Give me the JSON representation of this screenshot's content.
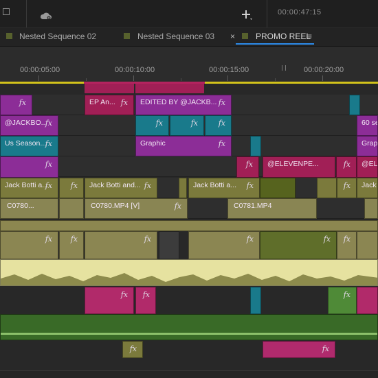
{
  "timecode": "00:00:47:15",
  "tabs": [
    {
      "label": "Nested Sequence 02"
    },
    {
      "label": "Nested Sequence 03"
    },
    {
      "label": "PROMO REEL",
      "close": "×",
      "menu": "≡"
    }
  ],
  "ruler": {
    "labels": [
      "00:00:05:00",
      "00:00:10:00",
      "00:00:15:00",
      "00:00:20:00"
    ]
  },
  "clips": {
    "ep_an": "EP An...",
    "edited_by": "EDITED BY @JACKB...",
    "jackbo": "@JACKBO...",
    "sixty_se": "60 se",
    "us_season": "Us Season...",
    "graphic": "Graphic",
    "graph": "Graph",
    "elevenpe": "@ELEVENPE...",
    "ele": "@ELE",
    "jack_botti_a": "Jack Botti a...",
    "jack_botti_and": "Jack Botti and...",
    "jack_botti_a2": "Jack Botti a...",
    "jack_b": "Jack B",
    "c0780": "C0780...",
    "c0780_v": "C0780.MP4 [V]",
    "c0781": "C0781.MP4",
    "fx": "fx"
  },
  "colors": {
    "accent": "#2d8ceb",
    "work_area": "#d3c31b",
    "graphic": "#8c2d97",
    "nested": "#a11f56",
    "video": "#898553",
    "audio": "#8b8652"
  }
}
